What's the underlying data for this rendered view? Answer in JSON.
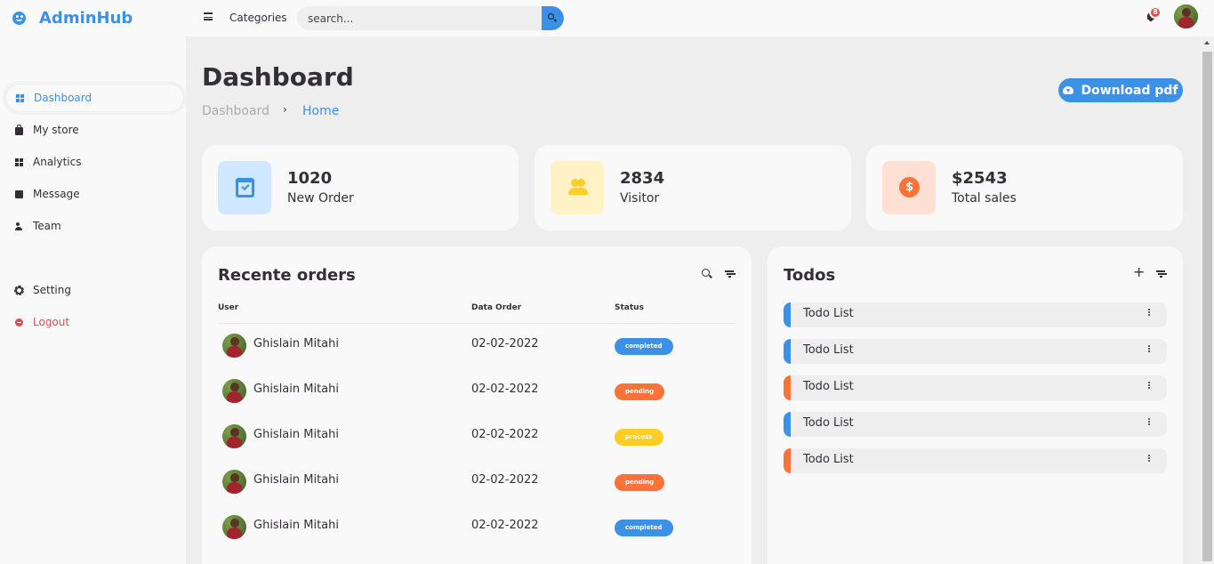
{
  "brand": {
    "name": "AdminHub",
    "icon": "smile-icon"
  },
  "sidebar": {
    "top_items": [
      {
        "label": "Dashboard",
        "icon": "grid-icon",
        "active": true
      },
      {
        "label": "My store",
        "icon": "bag-icon"
      },
      {
        "label": "Analytics",
        "icon": "grid-icon"
      },
      {
        "label": "Message",
        "icon": "message-icon"
      },
      {
        "label": "Team",
        "icon": "team-icon"
      }
    ],
    "bottom_items": [
      {
        "label": "Setting",
        "icon": "gear-icon"
      },
      {
        "label": "Logout",
        "icon": "logout-icon"
      }
    ]
  },
  "navbar": {
    "menu_icon": "hamburger-icon",
    "link": "Categories",
    "search_placeholder": "search...",
    "notification_count": "8"
  },
  "header": {
    "title": "Dashboard",
    "breadcrumb": [
      "Dashboard",
      "Home"
    ],
    "download_label": "Download pdf"
  },
  "stats": [
    {
      "value": "1020",
      "label": "New Order",
      "icon": "calendar-check-icon"
    },
    {
      "value": "2834",
      "label": "Visitor",
      "icon": "people-icon"
    },
    {
      "value": "$2543",
      "label": "Total sales",
      "icon": "dollar-icon"
    }
  ],
  "orders": {
    "title": "Recente orders",
    "columns": [
      "User",
      "Data Order",
      "Status"
    ],
    "rows": [
      {
        "user": "Ghislain Mitahi",
        "date": "02-02-2022",
        "status": "completed"
      },
      {
        "user": "Ghislain Mitahi",
        "date": "02-02-2022",
        "status": "pending"
      },
      {
        "user": "Ghislain Mitahi",
        "date": "02-02-2022",
        "status": "process"
      },
      {
        "user": "Ghislain Mitahi",
        "date": "02-02-2022",
        "status": "pending"
      },
      {
        "user": "Ghislain Mitahi",
        "date": "02-02-2022",
        "status": "completed"
      }
    ]
  },
  "todos": {
    "title": "Todos",
    "items": [
      {
        "label": "Todo List",
        "state": "completed"
      },
      {
        "label": "Todo List",
        "state": "completed"
      },
      {
        "label": "Todo List",
        "state": "not-completed"
      },
      {
        "label": "Todo List",
        "state": "completed"
      },
      {
        "label": "Todo List",
        "state": "not-completed"
      }
    ]
  },
  "colors": {
    "blue": "#3c91e6",
    "orange": "#fd7238",
    "yellow": "#ffce26",
    "red": "#db504a",
    "dark": "#342e37",
    "grey": "#eeeeee",
    "light": "#f9f9f9"
  }
}
